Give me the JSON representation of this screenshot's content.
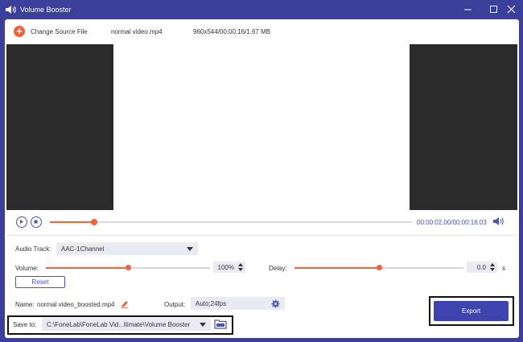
{
  "window": {
    "title": "Volume Booster",
    "icon": "speaker-icon"
  },
  "topbar": {
    "change_source_label": "Change Source File",
    "file_name": "normal video.mp4",
    "file_info": "960x544/00:00:16/1.67 MB"
  },
  "playback": {
    "current_time": "00:00:02.00",
    "separator": "/",
    "total_time": "00:00:16.03",
    "progress": 0.12
  },
  "audio": {
    "track_label": "Audio Track:",
    "track_value": "AAC-1Channel",
    "volume_label": "Volume:",
    "volume_value": "100%",
    "volume_level": 0.5,
    "delay_label": "Delay:",
    "delay_value": "0.0",
    "delay_unit": "s",
    "delay_level": 0.5,
    "reset_label": "Reset"
  },
  "output": {
    "name_label": "Name:",
    "name_value": "normal video_boosted.mp4",
    "output_label": "Output:",
    "output_value": "Auto;24fps",
    "save_label": "Save to:",
    "save_path": "C:\\FoneLab\\FoneLab Vid...ltimate\\Volume Booster",
    "export_label": "Export"
  },
  "colors": {
    "accent": "#3d44b0",
    "orange": "#f2603c",
    "titlebar": "#3a3f9a"
  }
}
